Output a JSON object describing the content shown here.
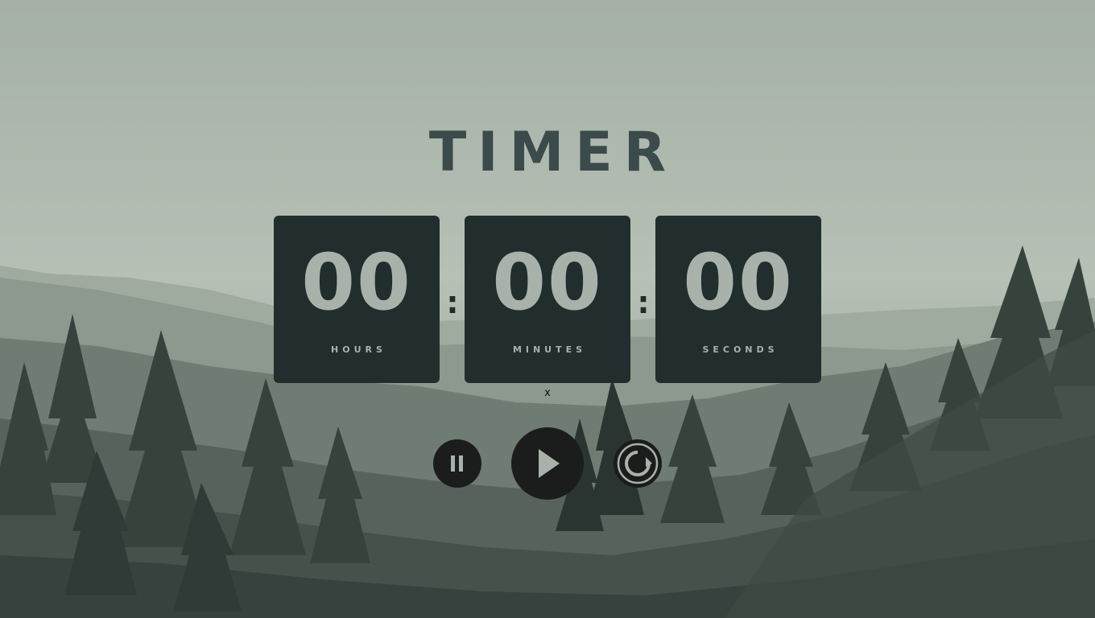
{
  "title": "TIMER",
  "timer": {
    "hours": {
      "value": "00",
      "label": "HOURS"
    },
    "minutes": {
      "value": "00",
      "label": "MINUTES"
    },
    "seconds": {
      "value": "00",
      "label": "SECONDS"
    },
    "separator": ":"
  },
  "close_label": "x",
  "controls": {
    "pause": {
      "icon": "pause-icon"
    },
    "play": {
      "icon": "play-icon"
    },
    "reset": {
      "icon": "reset-icon"
    }
  },
  "colors": {
    "card": "#212e2d",
    "digits": "#a8b2aa",
    "title": "#3b4a4a",
    "button": "#1b1d1c"
  }
}
